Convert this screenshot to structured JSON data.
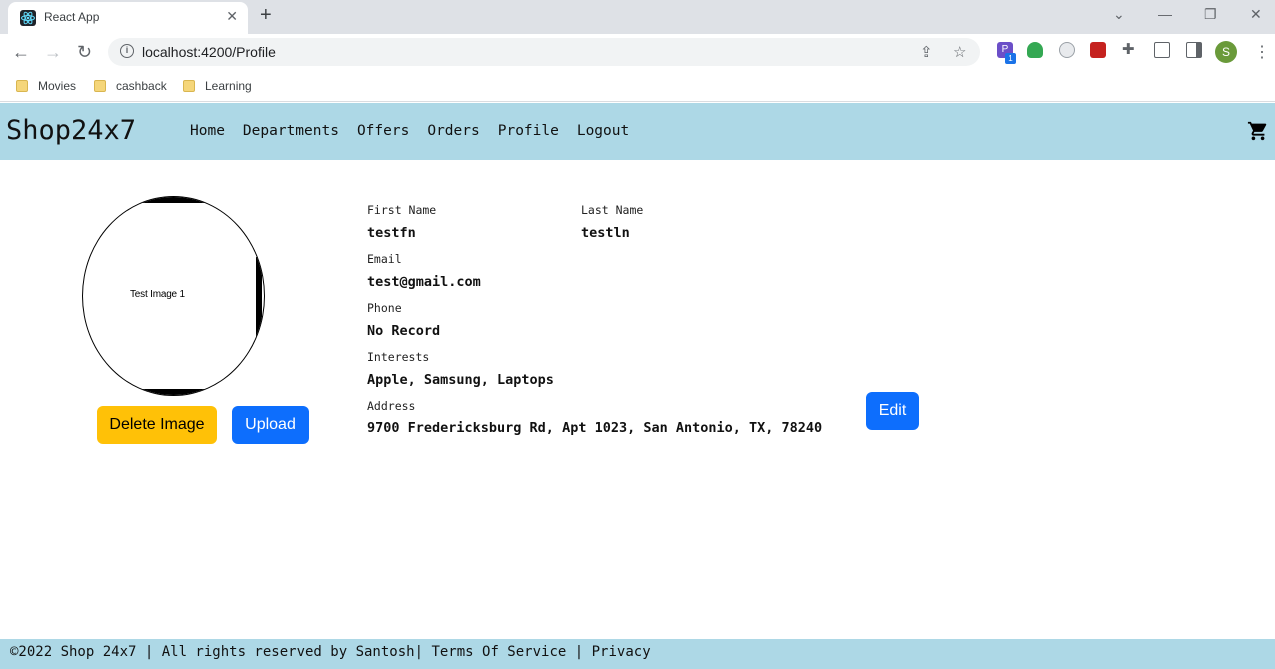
{
  "browser": {
    "tab_title": "React App",
    "url": "localhost:4200/Profile",
    "bookmarks": [
      "Movies",
      "cashback",
      "Learning"
    ],
    "profile_initial": "S",
    "extension_badge": "1"
  },
  "navbar": {
    "brand": "Shop24x7",
    "links": [
      "Home",
      "Departments",
      "Offers",
      "Orders",
      "Profile",
      "Logout"
    ]
  },
  "profile": {
    "image_text": "Test Image 1",
    "delete_label": "Delete Image",
    "upload_label": "Upload",
    "edit_label": "Edit",
    "fields": {
      "first_name_label": "First Name",
      "first_name": "testfn",
      "last_name_label": "Last Name",
      "last_name": "testln",
      "email_label": "Email",
      "email": "test@gmail.com",
      "phone_label": "Phone",
      "phone": "No Record",
      "interests_label": "Interests",
      "interests": "Apple, Samsung, Laptops",
      "address_label": "Address",
      "address": "9700 Fredericksburg Rd, Apt 1023, San Antonio, TX, 78240"
    }
  },
  "footer": {
    "copyright": "©2022 Shop 24x7 | All rights reserved by Santosh|",
    "terms": "Terms Of Service",
    "separator": "|",
    "privacy": "Privacy"
  },
  "colors": {
    "navbar_bg": "#add8e6",
    "primary": "#0d6efd",
    "warning": "#ffc107"
  }
}
